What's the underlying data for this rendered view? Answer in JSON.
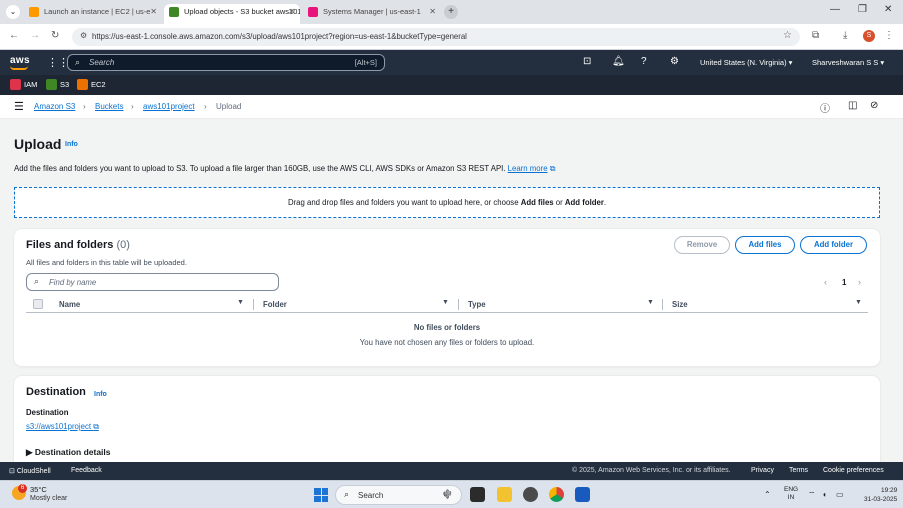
{
  "browser": {
    "tabs": [
      {
        "title": "Launch an instance | EC2 | us-e",
        "fav_color": "#ff9900",
        "active": false
      },
      {
        "title": "Upload objects - S3 bucket aws101p",
        "fav_color": "#3f8624",
        "active": true
      },
      {
        "title": "Systems Manager | us-east-1",
        "fav_color": "#e7157b",
        "active": false
      }
    ],
    "url": "https://us-east-1.console.aws.amazon.com/s3/upload/aws101project?region=us-east-1&bucketType=general",
    "profile_initial": "S"
  },
  "aws_nav": {
    "logo": "aws",
    "search_placeholder": "Search",
    "search_shortcut": "[Alt+S]",
    "region": "United States (N. Virginia) ▾",
    "user": "Sharveshwaran S S ▾"
  },
  "favorites": [
    {
      "label": "IAM",
      "color": "#dd344c"
    },
    {
      "label": "S3",
      "color": "#3f8624"
    },
    {
      "label": "EC2",
      "color": "#ed7100"
    }
  ],
  "breadcrumb": {
    "items": [
      "Amazon S3",
      "Buckets",
      "aws101project"
    ],
    "current": "Upload",
    "separator": "›"
  },
  "page": {
    "title": "Upload",
    "info": "Info",
    "description": "Add the files and folders you want to upload to S3. To upload a file larger than 160GB, use the AWS CLI, AWS SDKs or Amazon S3 REST API.",
    "learn_more": "Learn more",
    "dropzone_text": "Drag and drop files and folders you want to upload here, or choose ",
    "dropzone_add_files": "Add files",
    "dropzone_or": " or ",
    "dropzone_add_folder": "Add folder",
    "dropzone_end": "."
  },
  "files_panel": {
    "title": "Files and folders",
    "count": "(0)",
    "subtitle": "All files and folders in this table will be uploaded.",
    "remove_label": "Remove",
    "add_files_label": "Add files",
    "add_folder_label": "Add folder",
    "find_placeholder": "Find by name",
    "page_number": "1",
    "columns": [
      "Name",
      "Folder",
      "Type",
      "Size"
    ],
    "empty_title": "No files or folders",
    "empty_subtitle": "You have not chosen any files or folders to upload."
  },
  "destination": {
    "title": "Destination",
    "info": "Info",
    "label": "Destination",
    "link": "s3://aws101project",
    "details_label": "Destination details"
  },
  "footer": {
    "cloudshell": "CloudShell",
    "feedback": "Feedback",
    "copyright": "© 2025, Amazon Web Services, Inc. or its affiliates.",
    "privacy": "Privacy",
    "terms": "Terms",
    "cookies": "Cookie preferences"
  },
  "taskbar": {
    "weather_temp": "35°C",
    "weather_desc": "Mostly clear",
    "weather_badge": "6",
    "search_label": "Search",
    "lang_top": "ENG",
    "lang_bottom": "IN",
    "time": "19:29",
    "date": "31-03-2025"
  }
}
